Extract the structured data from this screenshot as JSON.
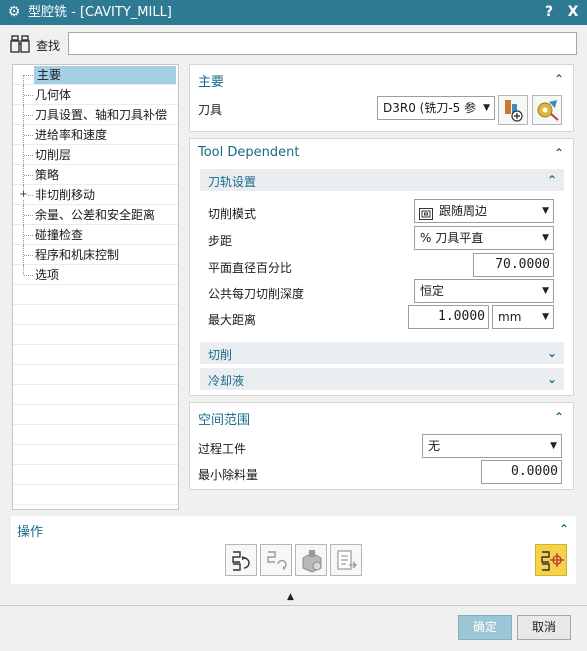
{
  "window": {
    "title": "型腔铣 - [CAVITY_MILL]",
    "help_label": "?",
    "close_label": "X",
    "app_icon": "gear-icon"
  },
  "find": {
    "label": "查找",
    "value": "",
    "icon": "binoculars-icon"
  },
  "tree": {
    "items": [
      {
        "label": "主要",
        "selected": true
      },
      {
        "label": "几何体"
      },
      {
        "label": "刀具设置、轴和刀具补偿"
      },
      {
        "label": "进给率和速度"
      },
      {
        "label": "切削层"
      },
      {
        "label": "策略"
      },
      {
        "label": "非切削移动",
        "expander": "+"
      },
      {
        "label": "余量、公差和安全距离"
      },
      {
        "label": "碰撞检查"
      },
      {
        "label": "程序和机床控制"
      },
      {
        "label": "选项"
      }
    ]
  },
  "main_section": {
    "title": "主要",
    "tool_label": "刀具",
    "tool_value": "D3R0 (铣刀-5 参",
    "icons": [
      "new-tool-icon",
      "edit-tool-icon"
    ]
  },
  "tool_dependent": {
    "title": "Tool Dependent",
    "path_settings": {
      "title": "刀轨设置",
      "cut_pattern_label": "切削模式",
      "cut_pattern_value": "跟随周边",
      "stepover_label": "步距",
      "stepover_value": "% 刀具平直",
      "flat_diameter_label": "平面直径百分比",
      "flat_diameter_value": "70.0000",
      "depth_label": "公共每刀切削深度",
      "depth_value": "恒定",
      "max_distance_label": "最大距离",
      "max_distance_value": "1.0000",
      "unit_value": "mm"
    },
    "cutting_title": "切削",
    "coolant_title": "冷却液"
  },
  "spatial": {
    "title": "空间范围",
    "process_workpiece_label": "过程工件",
    "process_workpiece_value": "无",
    "min_removal_label": "最小除料量",
    "min_removal_value": "0.0000"
  },
  "operations": {
    "title": "操作",
    "buttons": [
      "generate-icon",
      "replay-icon",
      "verify-icon",
      "list-icon",
      "display-icon"
    ]
  },
  "footer": {
    "ok_label": "确定",
    "cancel_label": "取消"
  },
  "colors": {
    "titlebar": "#2f7a93",
    "accent": "#1a6a8a",
    "selection": "#a4d0e6",
    "ok_button": "#9cc6d6",
    "op_highlight": "#f6d24a"
  }
}
